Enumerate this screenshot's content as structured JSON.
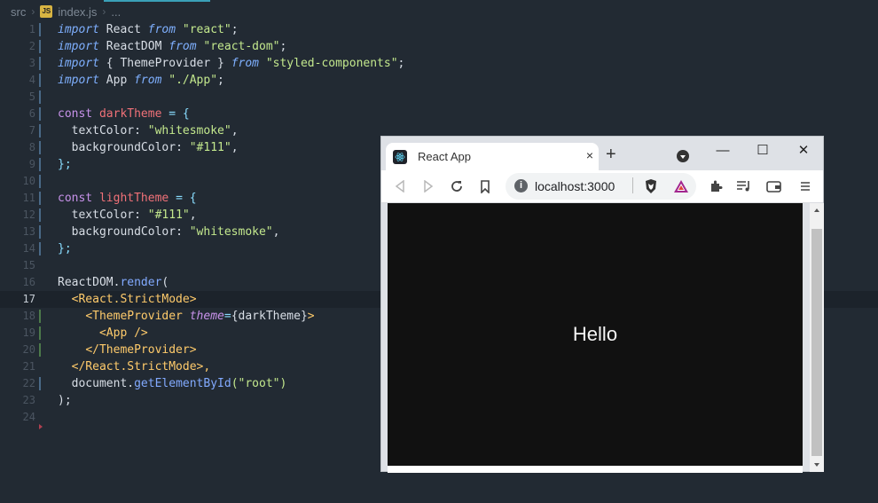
{
  "breadcrumb": {
    "folder": "src",
    "file": "index.js",
    "more": "..."
  },
  "editor": {
    "active_line": 17,
    "lines": [
      {
        "n": "1"
      },
      {
        "n": "2"
      },
      {
        "n": "3"
      },
      {
        "n": "4"
      },
      {
        "n": "5"
      },
      {
        "n": "6"
      },
      {
        "n": "7"
      },
      {
        "n": "8"
      },
      {
        "n": "9"
      },
      {
        "n": "10"
      },
      {
        "n": "11"
      },
      {
        "n": "12"
      },
      {
        "n": "13"
      },
      {
        "n": "14"
      },
      {
        "n": "15"
      },
      {
        "n": "16"
      },
      {
        "n": "17"
      },
      {
        "n": "18"
      },
      {
        "n": "19"
      },
      {
        "n": "20"
      },
      {
        "n": "21"
      },
      {
        "n": "22"
      },
      {
        "n": "23"
      },
      {
        "n": "24"
      }
    ],
    "tokens": {
      "import": "import",
      "from": "from",
      "const": "const",
      "react": "React",
      "react_str": "\"react\"",
      "reactdom": "ReactDOM",
      "reactdom_str": "\"react-dom\"",
      "theme_open": "{ ",
      "themeprovider": "ThemeProvider",
      "theme_close": " }",
      "styled_str": "\"styled-components\"",
      "app": "App",
      "app_str": "\"./App\"",
      "darkTheme": "darkTheme",
      "lightTheme": "lightTheme",
      "eq_brace": " = {",
      "textColor": "textColor",
      "backgroundColor": "backgroundColor",
      "whitesmoke": "\"whitesmoke\"",
      "hex111": "\"#111\"",
      "close_brace": "};",
      "render": "render",
      "render_open": "(",
      "strict_open": "<React.StrictMode>",
      "strict_close": "</React.StrictMode>,",
      "tp_open": "<ThemeProvider",
      "theme_attr": "theme",
      "tp_val": "{darkTheme}",
      "tp_gt": ">",
      "app_tag": "<App />",
      "tp_close": "</ThemeProvider>",
      "document": "document",
      "getById": "getElementById",
      "root_str": "(\"root\")",
      "end_paren": ");"
    }
  },
  "browser": {
    "tab_title": "React App",
    "tab_close": "×",
    "new_tab": "+",
    "win_min": "—",
    "win_max": "☐",
    "win_close": "✕",
    "url": "localhost:3000",
    "info_glyph": "i",
    "page_text": "Hello"
  },
  "colors": {
    "editor_bg": "#222a33",
    "page_bg": "#111111",
    "page_text": "#f5f5f5"
  }
}
